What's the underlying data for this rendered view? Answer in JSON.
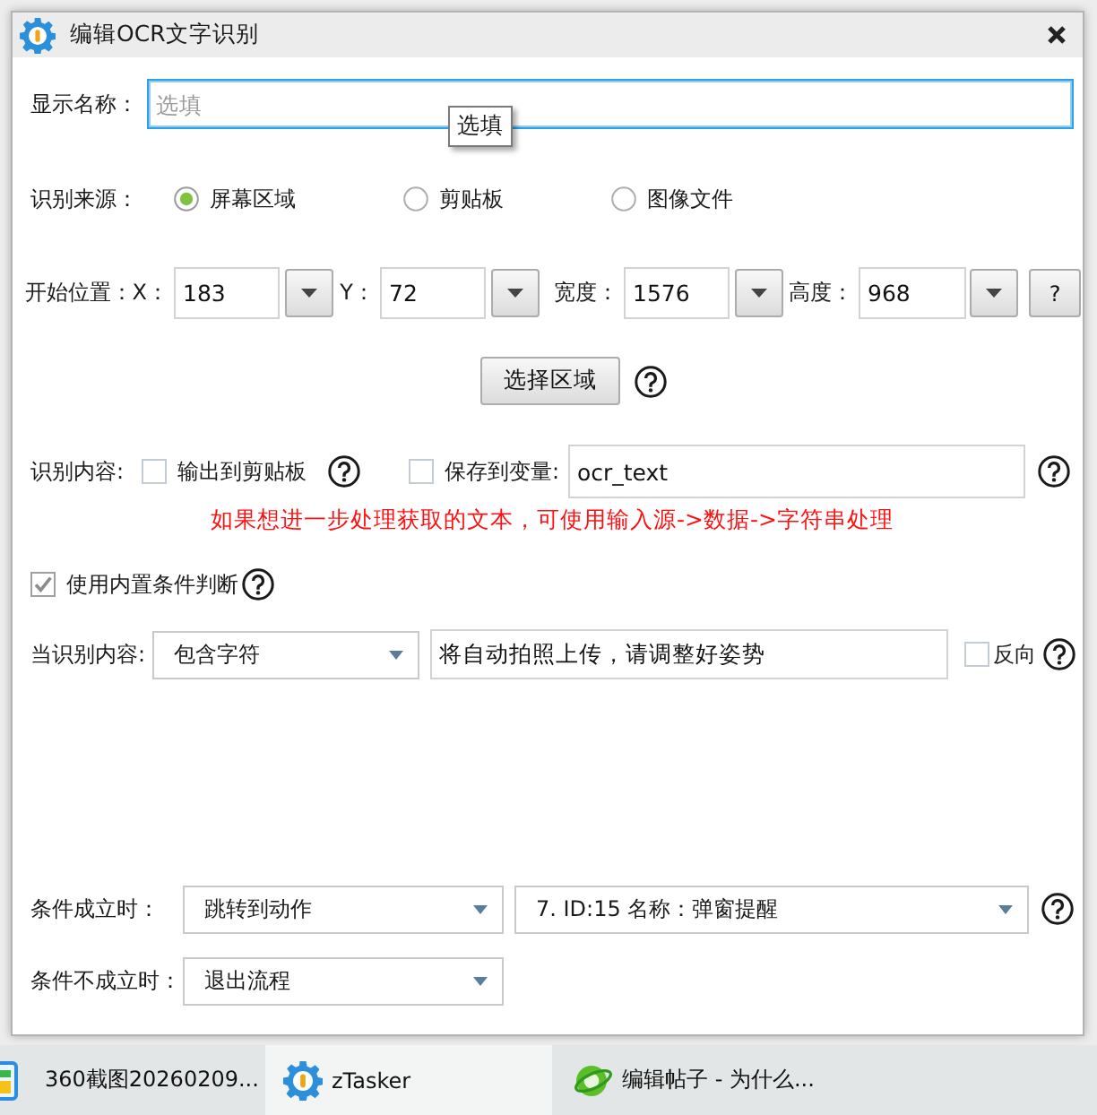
{
  "dialog": {
    "title": "编辑OCR文字识别",
    "display_name": {
      "label": "显示名称：",
      "placeholder": "选填",
      "focused": true,
      "tooltip": "选填"
    },
    "source": {
      "label": "识别来源：",
      "options": [
        {
          "label": "屏幕区域",
          "selected": true
        },
        {
          "label": "剪贴板",
          "selected": false
        },
        {
          "label": "图像文件",
          "selected": false
        }
      ]
    },
    "position": {
      "label": "开始位置：",
      "fields": [
        {
          "label": "X：",
          "value": "183"
        },
        {
          "label": "Y：",
          "value": "72"
        },
        {
          "label": "宽度：",
          "value": "1576"
        },
        {
          "label": "高度：",
          "value": "968"
        }
      ],
      "help_button": "?"
    },
    "select_area_button": "选择区域",
    "content": {
      "label": "识别内容:",
      "clipboard": {
        "label": "输出到剪贴板",
        "checked": false
      },
      "variable": {
        "label": "保存到变量:",
        "checked": false,
        "value": "ocr_text"
      }
    },
    "hint": "如果想进一步处理获取的文本，可使用输入源->数据->字符串处理",
    "builtin_condition": {
      "label": "使用内置条件判断",
      "checked": true
    },
    "condition": {
      "label": "当识别内容:",
      "operator": "包含字符",
      "value": "将自动拍照上传，请调整好姿势",
      "reverse": {
        "label": "反向",
        "checked": false
      }
    },
    "on_true": {
      "label": "条件成立时：",
      "action": "跳转到动作",
      "target": "7. ID:15 名称：弹窗提醒"
    },
    "on_false": {
      "label": "条件不成立时：",
      "action": "退出流程"
    }
  },
  "taskbar": {
    "items": [
      {
        "kind": "screenshot",
        "label": "360截图20260209...",
        "selected": false
      },
      {
        "kind": "app",
        "label": "zTasker",
        "selected": true
      },
      {
        "kind": "browser",
        "label": "编辑帖子 - 为什么...",
        "selected": false
      }
    ]
  }
}
